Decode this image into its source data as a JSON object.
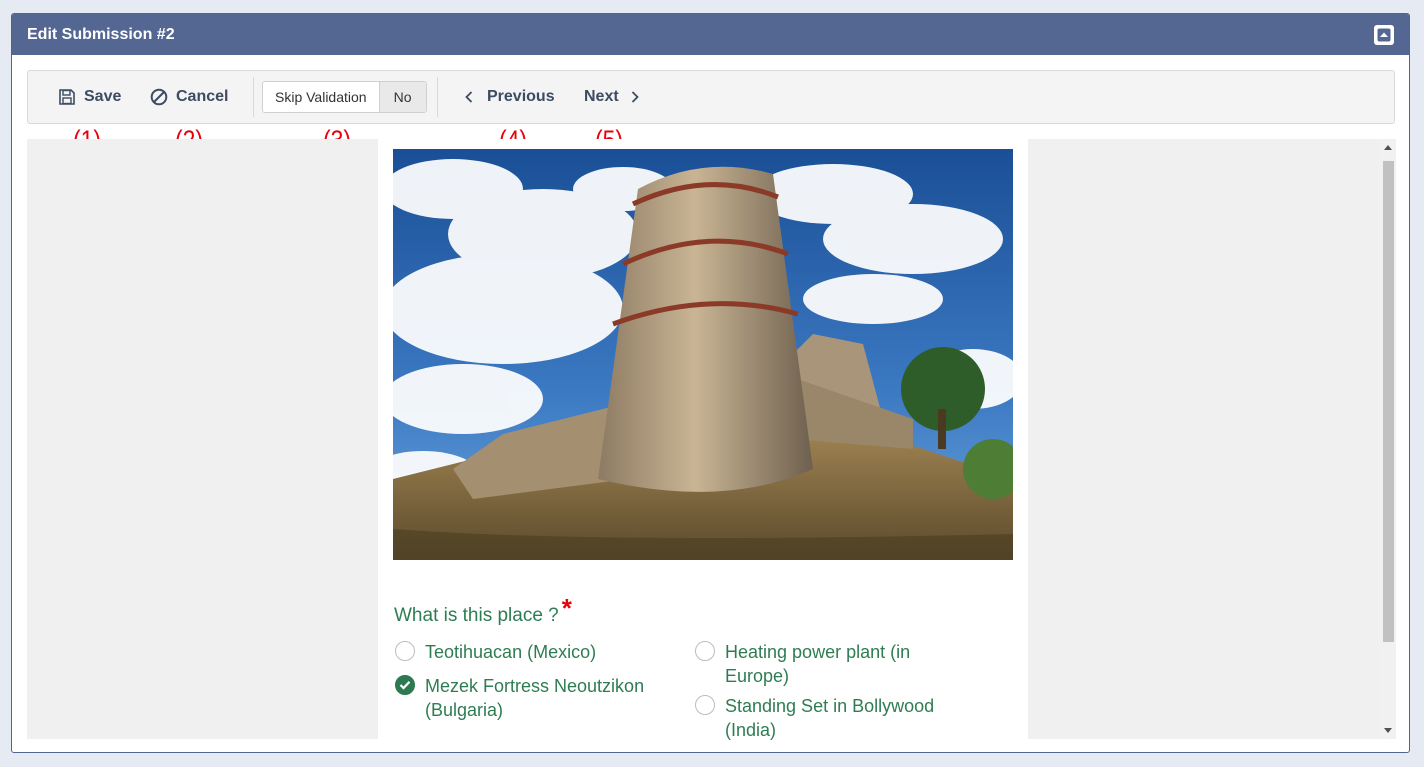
{
  "panel": {
    "title": "Edit Submission #2"
  },
  "toolbar": {
    "save_label": "Save",
    "cancel_label": "Cancel",
    "skip_validation_label": "Skip Validation",
    "skip_validation_value": "No",
    "previous_label": "Previous",
    "next_label": "Next"
  },
  "annotations": [
    "(1)",
    "(2)",
    "(3)",
    "(4)",
    "(5)"
  ],
  "form": {
    "question": "What is this place ?",
    "required_marker": "*",
    "options": [
      {
        "label_line1": "Teotihuacan (Mexico)",
        "label_line2": "",
        "checked": false
      },
      {
        "label_line1": "Mezek Fortress Neoutzikon",
        "label_line2": "(Bulgaria)",
        "checked": true
      },
      {
        "label_line1": "Heating power plant (in",
        "label_line2": "Europe)",
        "checked": false
      },
      {
        "label_line1": "Standing Set in Bollywood",
        "label_line2": "(India)",
        "checked": false
      }
    ]
  },
  "colors": {
    "header_bg": "#546792",
    "accent_green": "#2e7d52",
    "required_red": "#e8000b"
  }
}
